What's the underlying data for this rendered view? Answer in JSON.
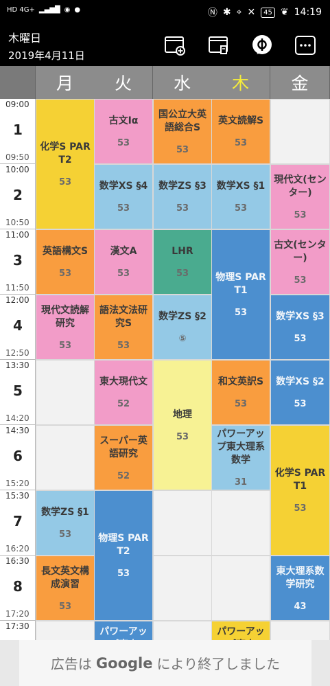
{
  "status_bar": {
    "network": "HD 4G+",
    "battery": "45",
    "time": "14:19"
  },
  "header": {
    "weekday": "木曜日",
    "date": "2019年4月11日"
  },
  "days": [
    {
      "label": "月",
      "today": false
    },
    {
      "label": "火",
      "today": false
    },
    {
      "label": "水",
      "today": false
    },
    {
      "label": "木",
      "today": true
    },
    {
      "label": "金",
      "today": false
    }
  ],
  "periods": [
    {
      "num": "1",
      "start": "09:00",
      "end": "09:50"
    },
    {
      "num": "2",
      "start": "10:00",
      "end": "10:50"
    },
    {
      "num": "3",
      "start": "11:00",
      "end": "11:50"
    },
    {
      "num": "4",
      "start": "12:00",
      "end": "12:50"
    },
    {
      "num": "5",
      "start": "13:30",
      "end": "14:20"
    },
    {
      "num": "6",
      "start": "14:30",
      "end": "15:20"
    },
    {
      "num": "7",
      "start": "15:30",
      "end": "16:20"
    },
    {
      "num": "8",
      "start": "16:30",
      "end": "17:20"
    },
    {
      "num": "",
      "start": "17:30",
      "end": ""
    }
  ],
  "colors": {
    "yellow": "#f5d134",
    "pink": "#f29cc8",
    "orange": "#f99d3f",
    "lightblue": "#94c9e6",
    "blue": "#4c8fcf",
    "teal": "#4aab8f",
    "paleyellow": "#f7f294",
    "empty": "#f2f2f2"
  },
  "classes": [
    {
      "day": 0,
      "start": 0,
      "span": 2,
      "name": "化学S PAR T2",
      "room": "53",
      "color": "yellow"
    },
    {
      "day": 0,
      "start": 2,
      "span": 1,
      "name": "英語構文S",
      "room": "53",
      "color": "orange"
    },
    {
      "day": 0,
      "start": 3,
      "span": 1,
      "name": "現代文読解研究",
      "room": "53",
      "color": "pink"
    },
    {
      "day": 0,
      "start": 4,
      "span": 1,
      "name": "",
      "room": "",
      "color": "empty"
    },
    {
      "day": 0,
      "start": 5,
      "span": 1,
      "name": "",
      "room": "",
      "color": "empty"
    },
    {
      "day": 0,
      "start": 6,
      "span": 1,
      "name": "数学ZS §1",
      "room": "53",
      "color": "lightblue"
    },
    {
      "day": 0,
      "start": 7,
      "span": 1,
      "name": "長文英文構成演習",
      "room": "53",
      "color": "orange"
    },
    {
      "day": 0,
      "start": 8,
      "span": 1,
      "name": "",
      "room": "",
      "color": "empty"
    },
    {
      "day": 1,
      "start": 0,
      "span": 1,
      "name": "古文Iα",
      "room": "53",
      "color": "pink"
    },
    {
      "day": 1,
      "start": 1,
      "span": 1,
      "name": "数学XS §4",
      "room": "53",
      "color": "lightblue"
    },
    {
      "day": 1,
      "start": 2,
      "span": 1,
      "name": "漢文A",
      "room": "53",
      "color": "pink"
    },
    {
      "day": 1,
      "start": 3,
      "span": 1,
      "name": "語法文法研究S",
      "room": "53",
      "color": "orange"
    },
    {
      "day": 1,
      "start": 4,
      "span": 1,
      "name": "東大現代文",
      "room": "52",
      "color": "pink"
    },
    {
      "day": 1,
      "start": 5,
      "span": 1,
      "name": "スーパー英語研究",
      "room": "52",
      "color": "orange"
    },
    {
      "day": 1,
      "start": 6,
      "span": 2,
      "name": "物理S PAR T2",
      "room": "53",
      "color": "blue"
    },
    {
      "day": 1,
      "start": 8,
      "span": 1,
      "name": "パワーアップ東大",
      "room": "",
      "color": "blue",
      "clip": true
    },
    {
      "day": 2,
      "start": 0,
      "span": 1,
      "name": "国公立大英語総合S",
      "room": "53",
      "color": "orange"
    },
    {
      "day": 2,
      "start": 1,
      "span": 1,
      "name": "数学ZS §3",
      "room": "53",
      "color": "lightblue"
    },
    {
      "day": 2,
      "start": 2,
      "span": 1,
      "name": "LHR",
      "room": "53",
      "color": "teal"
    },
    {
      "day": 2,
      "start": 3,
      "span": 1,
      "name": "数学ZS §2",
      "room": "⑤",
      "color": "lightblue"
    },
    {
      "day": 2,
      "start": 4,
      "span": 2,
      "name": "地理",
      "room": "53",
      "color": "paleyellow"
    },
    {
      "day": 2,
      "start": 6,
      "span": 1,
      "name": "",
      "room": "",
      "color": "empty"
    },
    {
      "day": 2,
      "start": 7,
      "span": 1,
      "name": "",
      "room": "",
      "color": "empty"
    },
    {
      "day": 2,
      "start": 8,
      "span": 1,
      "name": "",
      "room": "",
      "color": "empty"
    },
    {
      "day": 3,
      "start": 0,
      "span": 1,
      "name": "英文読解S",
      "room": "53",
      "color": "orange"
    },
    {
      "day": 3,
      "start": 1,
      "span": 1,
      "name": "数学XS §1",
      "room": "53",
      "color": "lightblue"
    },
    {
      "day": 3,
      "start": 2,
      "span": 2,
      "name": "物理S PAR T1",
      "room": "53",
      "color": "blue"
    },
    {
      "day": 3,
      "start": 4,
      "span": 1,
      "name": "和文英訳S",
      "room": "53",
      "color": "orange"
    },
    {
      "day": 3,
      "start": 5,
      "span": 1,
      "name": "パワーアップ東大理系数学",
      "room": "31",
      "color": "lightblue"
    },
    {
      "day": 3,
      "start": 6,
      "span": 1,
      "name": "",
      "room": "",
      "color": "empty"
    },
    {
      "day": 3,
      "start": 7,
      "span": 1,
      "name": "",
      "room": "",
      "color": "empty"
    },
    {
      "day": 3,
      "start": 8,
      "span": 1,
      "name": "パワーアップ東大",
      "room": "",
      "color": "yellow",
      "clip": true
    },
    {
      "day": 4,
      "start": 0,
      "span": 1,
      "name": "",
      "room": "",
      "color": "empty"
    },
    {
      "day": 4,
      "start": 1,
      "span": 1,
      "name": "現代文(センター)",
      "room": "53",
      "color": "pink"
    },
    {
      "day": 4,
      "start": 2,
      "span": 1,
      "name": "古文(センター)",
      "room": "53",
      "color": "pink"
    },
    {
      "day": 4,
      "start": 3,
      "span": 1,
      "name": "数学XS §3",
      "room": "53",
      "color": "blue"
    },
    {
      "day": 4,
      "start": 4,
      "span": 1,
      "name": "数学XS §2",
      "room": "53",
      "color": "blue"
    },
    {
      "day": 4,
      "start": 5,
      "span": 2,
      "name": "化学S PAR T1",
      "room": "53",
      "color": "yellow"
    },
    {
      "day": 4,
      "start": 7,
      "span": 1,
      "name": "東大理系数学研究",
      "room": "43",
      "color": "blue"
    },
    {
      "day": 4,
      "start": 8,
      "span": 1,
      "name": "",
      "room": "",
      "color": "empty"
    }
  ],
  "ad": {
    "prefix": "広告は",
    "brand": "Google",
    "suffix": "により終了しました"
  }
}
